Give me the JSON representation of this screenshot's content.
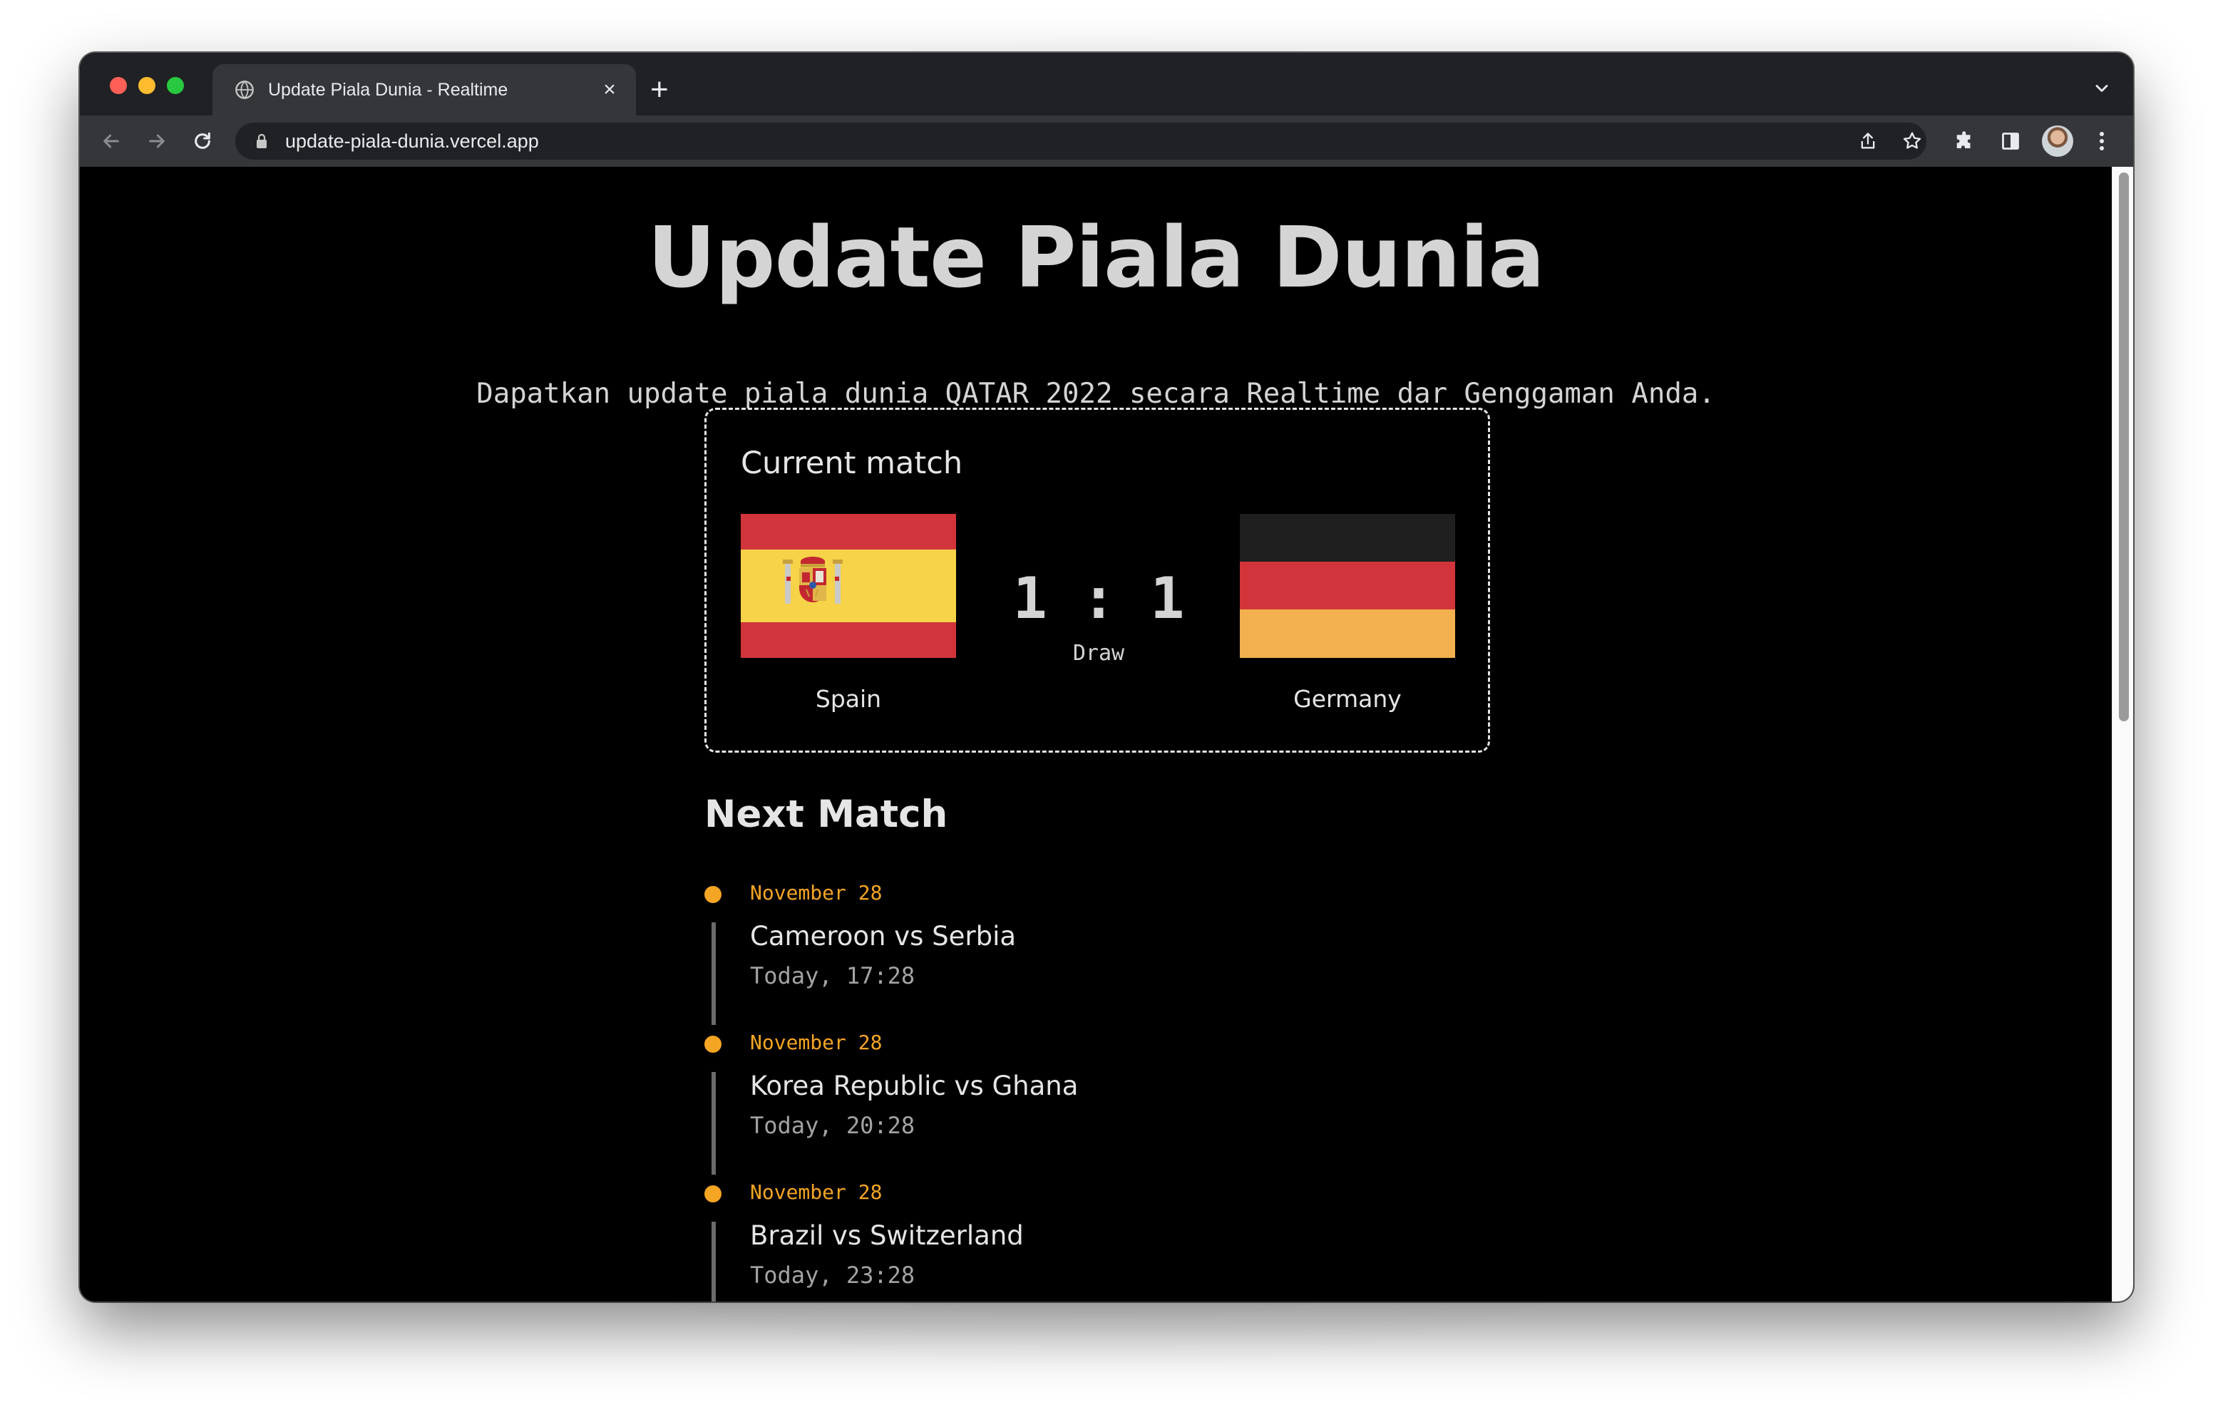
{
  "browser": {
    "tab_title": "Update Piala Dunia - Realtime",
    "tab_close": "×",
    "new_tab": "+",
    "url": "update-piala-dunia.vercel.app"
  },
  "page": {
    "title": "Update Piala Dunia",
    "subtitle": "Dapatkan update piala dunia QATAR 2022 secara Realtime dar Genggaman Anda."
  },
  "current_match": {
    "heading": "Current match",
    "home_team": "Spain",
    "away_team": "Germany",
    "score": "1 : 1",
    "result": "Draw",
    "colors": {
      "spain_red": "#d2343b",
      "spain_yellow": "#f6d348",
      "germany_black": "#1f1f1f",
      "germany_red": "#d2343b",
      "germany_gold": "#f2b14e"
    }
  },
  "next_match": {
    "heading": "Next Match",
    "accent_color": "#f5a524",
    "items": [
      {
        "date": "November 28",
        "teams": "Cameroon vs Serbia",
        "time": "Today, 17:28"
      },
      {
        "date": "November 28",
        "teams": "Korea Republic vs Ghana",
        "time": "Today, 20:28"
      },
      {
        "date": "November 28",
        "teams": "Brazil vs Switzerland",
        "time": "Today, 23:28"
      }
    ]
  },
  "icons": {
    "tab_favicon": "globe-icon",
    "back": "arrow-left-icon",
    "forward": "arrow-right-icon",
    "reload": "reload-icon",
    "lock": "lock-icon",
    "share": "share-icon",
    "bookmark": "star-icon",
    "extensions": "puzzle-icon",
    "side_panel": "side-panel-icon",
    "menu": "kebab-menu-icon",
    "tab_list": "chevron-down-icon"
  }
}
